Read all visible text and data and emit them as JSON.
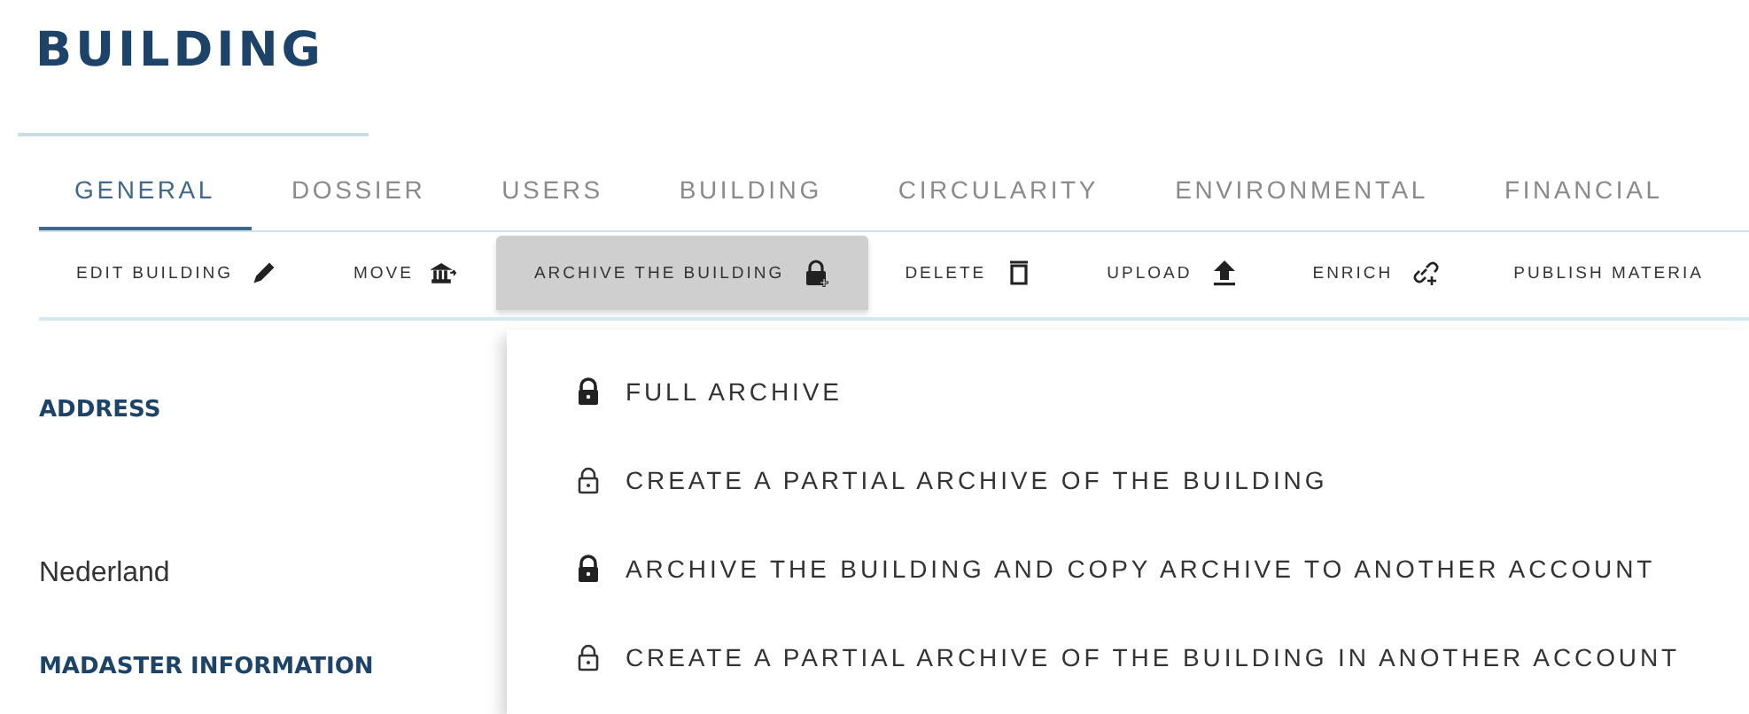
{
  "page_title": "BUILDING",
  "tabs": [
    {
      "label": "GENERAL",
      "selected": true
    },
    {
      "label": "DOSSIER",
      "selected": false
    },
    {
      "label": "USERS",
      "selected": false
    },
    {
      "label": "BUILDING",
      "selected": false
    },
    {
      "label": "CIRCULARITY",
      "selected": false
    },
    {
      "label": "ENVIRONMENTAL",
      "selected": false
    },
    {
      "label": "FINANCIAL",
      "selected": false
    }
  ],
  "toolbar": [
    {
      "label": "EDIT BUILDING",
      "kind": "edit",
      "active": false
    },
    {
      "label": "MOVE",
      "kind": "move",
      "active": false
    },
    {
      "label": "ARCHIVE THE BUILDING",
      "kind": "archive",
      "active": true
    },
    {
      "label": "DELETE",
      "kind": "delete",
      "active": false
    },
    {
      "label": "UPLOAD",
      "kind": "upload",
      "active": false
    },
    {
      "label": "ENRICH",
      "kind": "enrich",
      "active": false
    },
    {
      "label": "PUBLISH MATERIA",
      "kind": "text",
      "active": false
    }
  ],
  "sections": [
    {
      "heading": "ADDRESS",
      "value": "Nederland"
    },
    {
      "heading": "MADASTER INFORMATION"
    }
  ],
  "archive_menu": [
    {
      "label": "FULL ARCHIVE",
      "kind": "full"
    },
    {
      "label": "CREATE A PARTIAL ARCHIVE OF THE BUILDING",
      "kind": "partial"
    },
    {
      "label": "ARCHIVE THE BUILDING AND COPY ARCHIVE TO ANOTHER ACCOUNT",
      "kind": "full"
    },
    {
      "label": "CREATE A PARTIAL ARCHIVE OF THE BUILDING IN ANOTHER ACCOUNT",
      "kind": "partial"
    }
  ]
}
